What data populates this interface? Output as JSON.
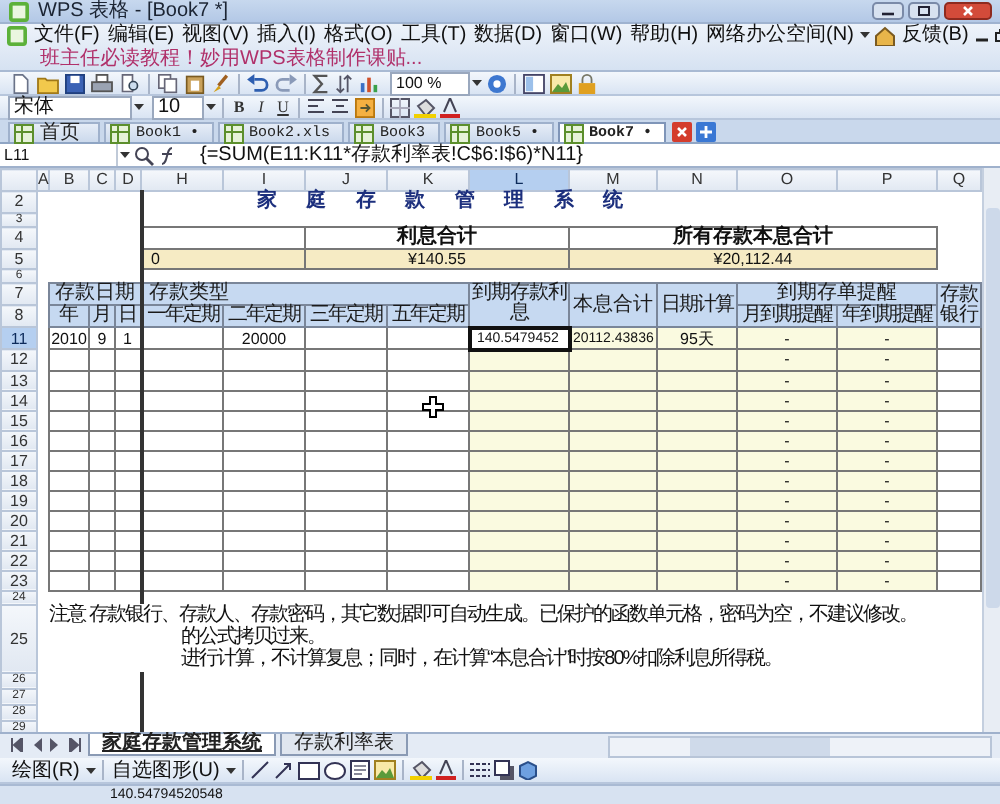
{
  "window": {
    "title": "WPS 表格 - [Book7 *]"
  },
  "menu_bar": {
    "items": [
      "文件(F)",
      "编辑(E)",
      "视图(V)",
      "插入(I)",
      "格式(O)",
      "工具(T)",
      "数据(D)",
      "窗口(W)",
      "帮助(H)",
      "网络办公空间(N)"
    ],
    "feedback": "反馈(B)",
    "promo": "班主任必读教程！妙用WPS表格制作课贴..."
  },
  "standard_toolbar": {
    "zoom": "100 %"
  },
  "format_toolbar": {
    "font": "宋体",
    "size": "10",
    "style_buttons": [
      "B",
      "I",
      "U"
    ]
  },
  "document_tabs": [
    {
      "label": "首页",
      "selected": false
    },
    {
      "label": "Book1 •",
      "selected": false
    },
    {
      "label": "Book2.xls",
      "selected": false
    },
    {
      "label": "Book3",
      "selected": false
    },
    {
      "label": "Book5 •",
      "selected": false
    },
    {
      "label": "Book7 •",
      "selected": true
    }
  ],
  "formula_bar": {
    "cell": "L11",
    "formula": "{=SUM(E11:K11*存款利率表!C$6:I$6)*N11}"
  },
  "columns": [
    {
      "label": "A",
      "selected": false
    },
    {
      "label": "B",
      "selected": false
    },
    {
      "label": "C",
      "selected": false
    },
    {
      "label": "D",
      "selected": false
    },
    {
      "label": "H",
      "selected": false
    },
    {
      "label": "I",
      "selected": false
    },
    {
      "label": "J",
      "selected": false
    },
    {
      "label": "K",
      "selected": false
    },
    {
      "label": "L",
      "selected": true
    },
    {
      "label": "M",
      "selected": false
    },
    {
      "label": "N",
      "selected": false
    },
    {
      "label": "O",
      "selected": false
    },
    {
      "label": "P",
      "selected": false
    },
    {
      "label": "Q",
      "selected": false
    }
  ],
  "sheet": {
    "title": "家 庭 存 款 管 理 系 统",
    "summary": {
      "cut_value": "0",
      "items": [
        {
          "label": "利息合计",
          "value": "¥140.55"
        },
        {
          "label": "所有存款本息合计",
          "value": "¥20,112.44"
        }
      ]
    },
    "header": {
      "date_group": "存款日期",
      "date_columns": [
        "年",
        "月",
        "日"
      ],
      "type_group": "存款类型",
      "type_columns": [
        "一年定期",
        "二年定期",
        "三年定期",
        "五年定期"
      ],
      "interest": "到期存款利息",
      "total": "本息合计",
      "days": "日期计算",
      "reminder_group": "到期存单提醒",
      "reminder_columns": [
        "月到期提醒",
        "年到期提醒"
      ],
      "bank": "存款银行"
    },
    "notes": [
      "注意 存款银行、存款人、存款密码，其它数据即可自动生成。已保护的函数单元格，密码为空，不建议修改。",
      "的公式拷贝过来。",
      "进行计算，不计算复息；同时，在计算“本息合计”时按80%扣除利息所得税。"
    ],
    "rows": [
      {
        "number": "2",
        "selected": false,
        "kind": "title"
      },
      {
        "number": "3",
        "selected": false,
        "kind": "blank"
      },
      {
        "number": "4",
        "selected": false,
        "kind": "summary_label"
      },
      {
        "number": "5",
        "selected": false,
        "kind": "summary_value"
      },
      {
        "number": "6",
        "selected": false,
        "kind": "blank"
      },
      {
        "number": "7",
        "selected": false,
        "kind": "header_top"
      },
      {
        "number": "8",
        "selected": false,
        "kind": "header_bottom"
      },
      {
        "number": "11",
        "selected": true,
        "kind": "record",
        "cells": {
          "year": "2010",
          "month": "9",
          "day": "1",
          "two_year": "20000",
          "interest": "140.5479452",
          "total": "20112.43836",
          "days": "95天",
          "month_reminder": "-",
          "year_reminder": "-"
        }
      },
      {
        "number": "12",
        "selected": false,
        "kind": "record",
        "cells": {
          "month_reminder": "-",
          "year_reminder": "-"
        }
      },
      {
        "number": "13",
        "selected": false,
        "kind": "record",
        "cells": {
          "month_reminder": "-",
          "year_reminder": "-"
        }
      },
      {
        "number": "14",
        "selected": false,
        "kind": "record",
        "cells": {
          "month_reminder": "-",
          "year_reminder": "-"
        }
      },
      {
        "number": "15",
        "selected": false,
        "kind": "record",
        "cells": {
          "month_reminder": "-",
          "year_reminder": "-"
        }
      },
      {
        "number": "16",
        "selected": false,
        "kind": "record",
        "cells": {
          "month_reminder": "-",
          "year_reminder": "-"
        }
      },
      {
        "number": "17",
        "selected": false,
        "kind": "record",
        "cells": {
          "month_reminder": "-",
          "year_reminder": "-"
        }
      },
      {
        "number": "18",
        "selected": false,
        "kind": "record",
        "cells": {
          "month_reminder": "-",
          "year_reminder": "-"
        }
      },
      {
        "number": "19",
        "selected": false,
        "kind": "record",
        "cells": {
          "month_reminder": "-",
          "year_reminder": "-"
        }
      },
      {
        "number": "20",
        "selected": false,
        "kind": "record",
        "cells": {
          "month_reminder": "-",
          "year_reminder": "-"
        }
      },
      {
        "number": "21",
        "selected": false,
        "kind": "record",
        "cells": {
          "month_reminder": "-",
          "year_reminder": "-"
        }
      },
      {
        "number": "22",
        "selected": false,
        "kind": "record",
        "cells": {
          "month_reminder": "-",
          "year_reminder": "-"
        }
      },
      {
        "number": "23",
        "selected": false,
        "kind": "record",
        "cells": {
          "month_reminder": "-",
          "year_reminder": "-"
        }
      },
      {
        "number": "24",
        "selected": false,
        "kind": "blank"
      },
      {
        "number": "25",
        "selected": false,
        "kind": "note"
      },
      {
        "number": "26",
        "selected": false,
        "kind": "tail"
      },
      {
        "number": "27",
        "selected": false,
        "kind": "tail"
      },
      {
        "number": "28",
        "selected": false,
        "kind": "tail"
      },
      {
        "number": "29",
        "selected": false,
        "kind": "tail"
      }
    ]
  },
  "sheet_tabs": [
    {
      "label": "家庭存款管理系统",
      "selected": true
    },
    {
      "label": "存款利率表",
      "selected": false
    }
  ],
  "drawing_toolbar": {
    "items": [
      "绘图(R)",
      "自选图形(U)"
    ]
  },
  "status_bar": {
    "text": "140.54794520548"
  }
}
